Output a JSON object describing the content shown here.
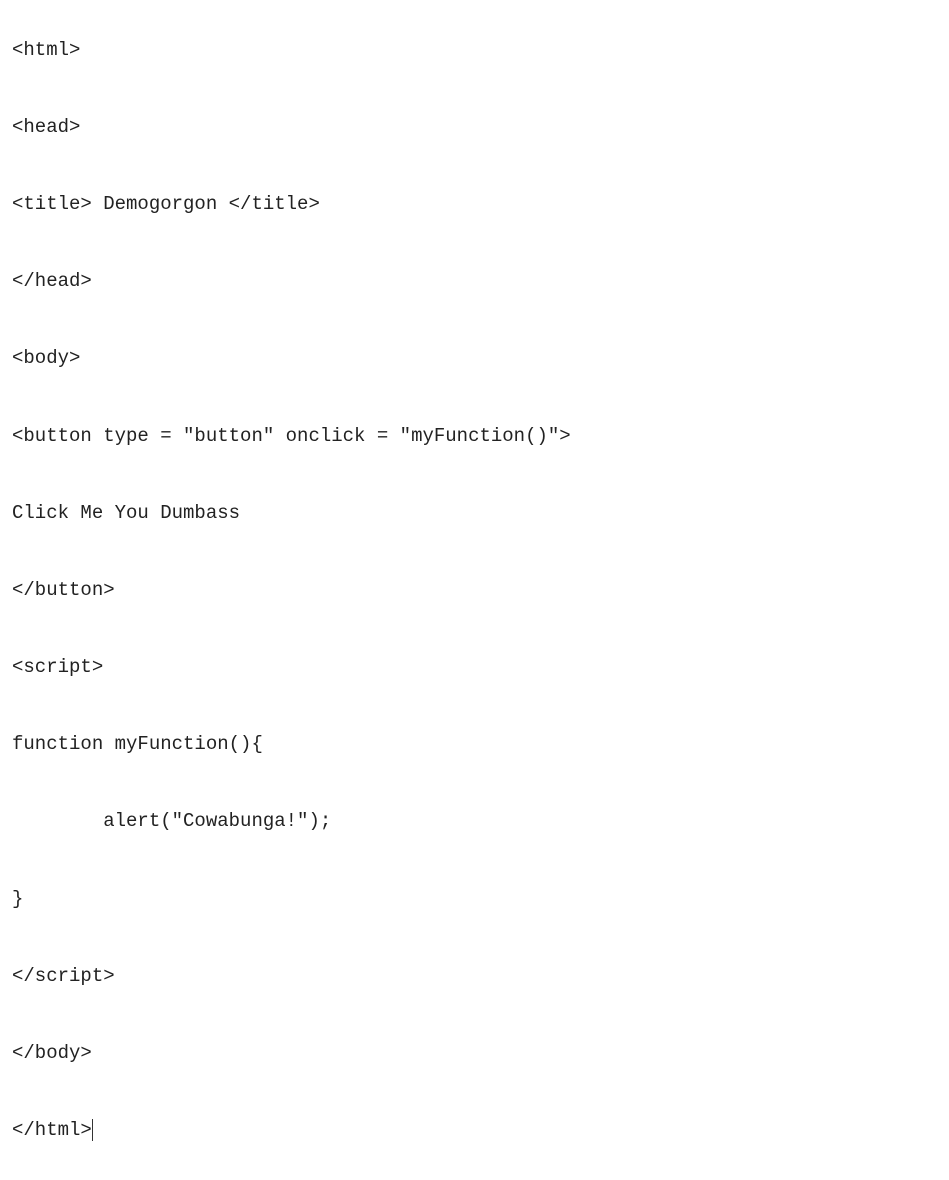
{
  "code": {
    "line1": "<html>",
    "line2": "<head>",
    "line3": "<title> Demogorgon </title>",
    "line4": "</head>",
    "line5": "<body>",
    "line6": "<button type = \"button\" onclick = \"myFunction()\">",
    "line7": "Click Me You Dumbass",
    "line8": "</button>",
    "line9": "<script>",
    "line10": "function myFunction(){",
    "line11": "        alert(\"Cowabunga!\");",
    "line12": "}",
    "line13": "</script>",
    "line14": "</body>",
    "line15": "</html>"
  }
}
